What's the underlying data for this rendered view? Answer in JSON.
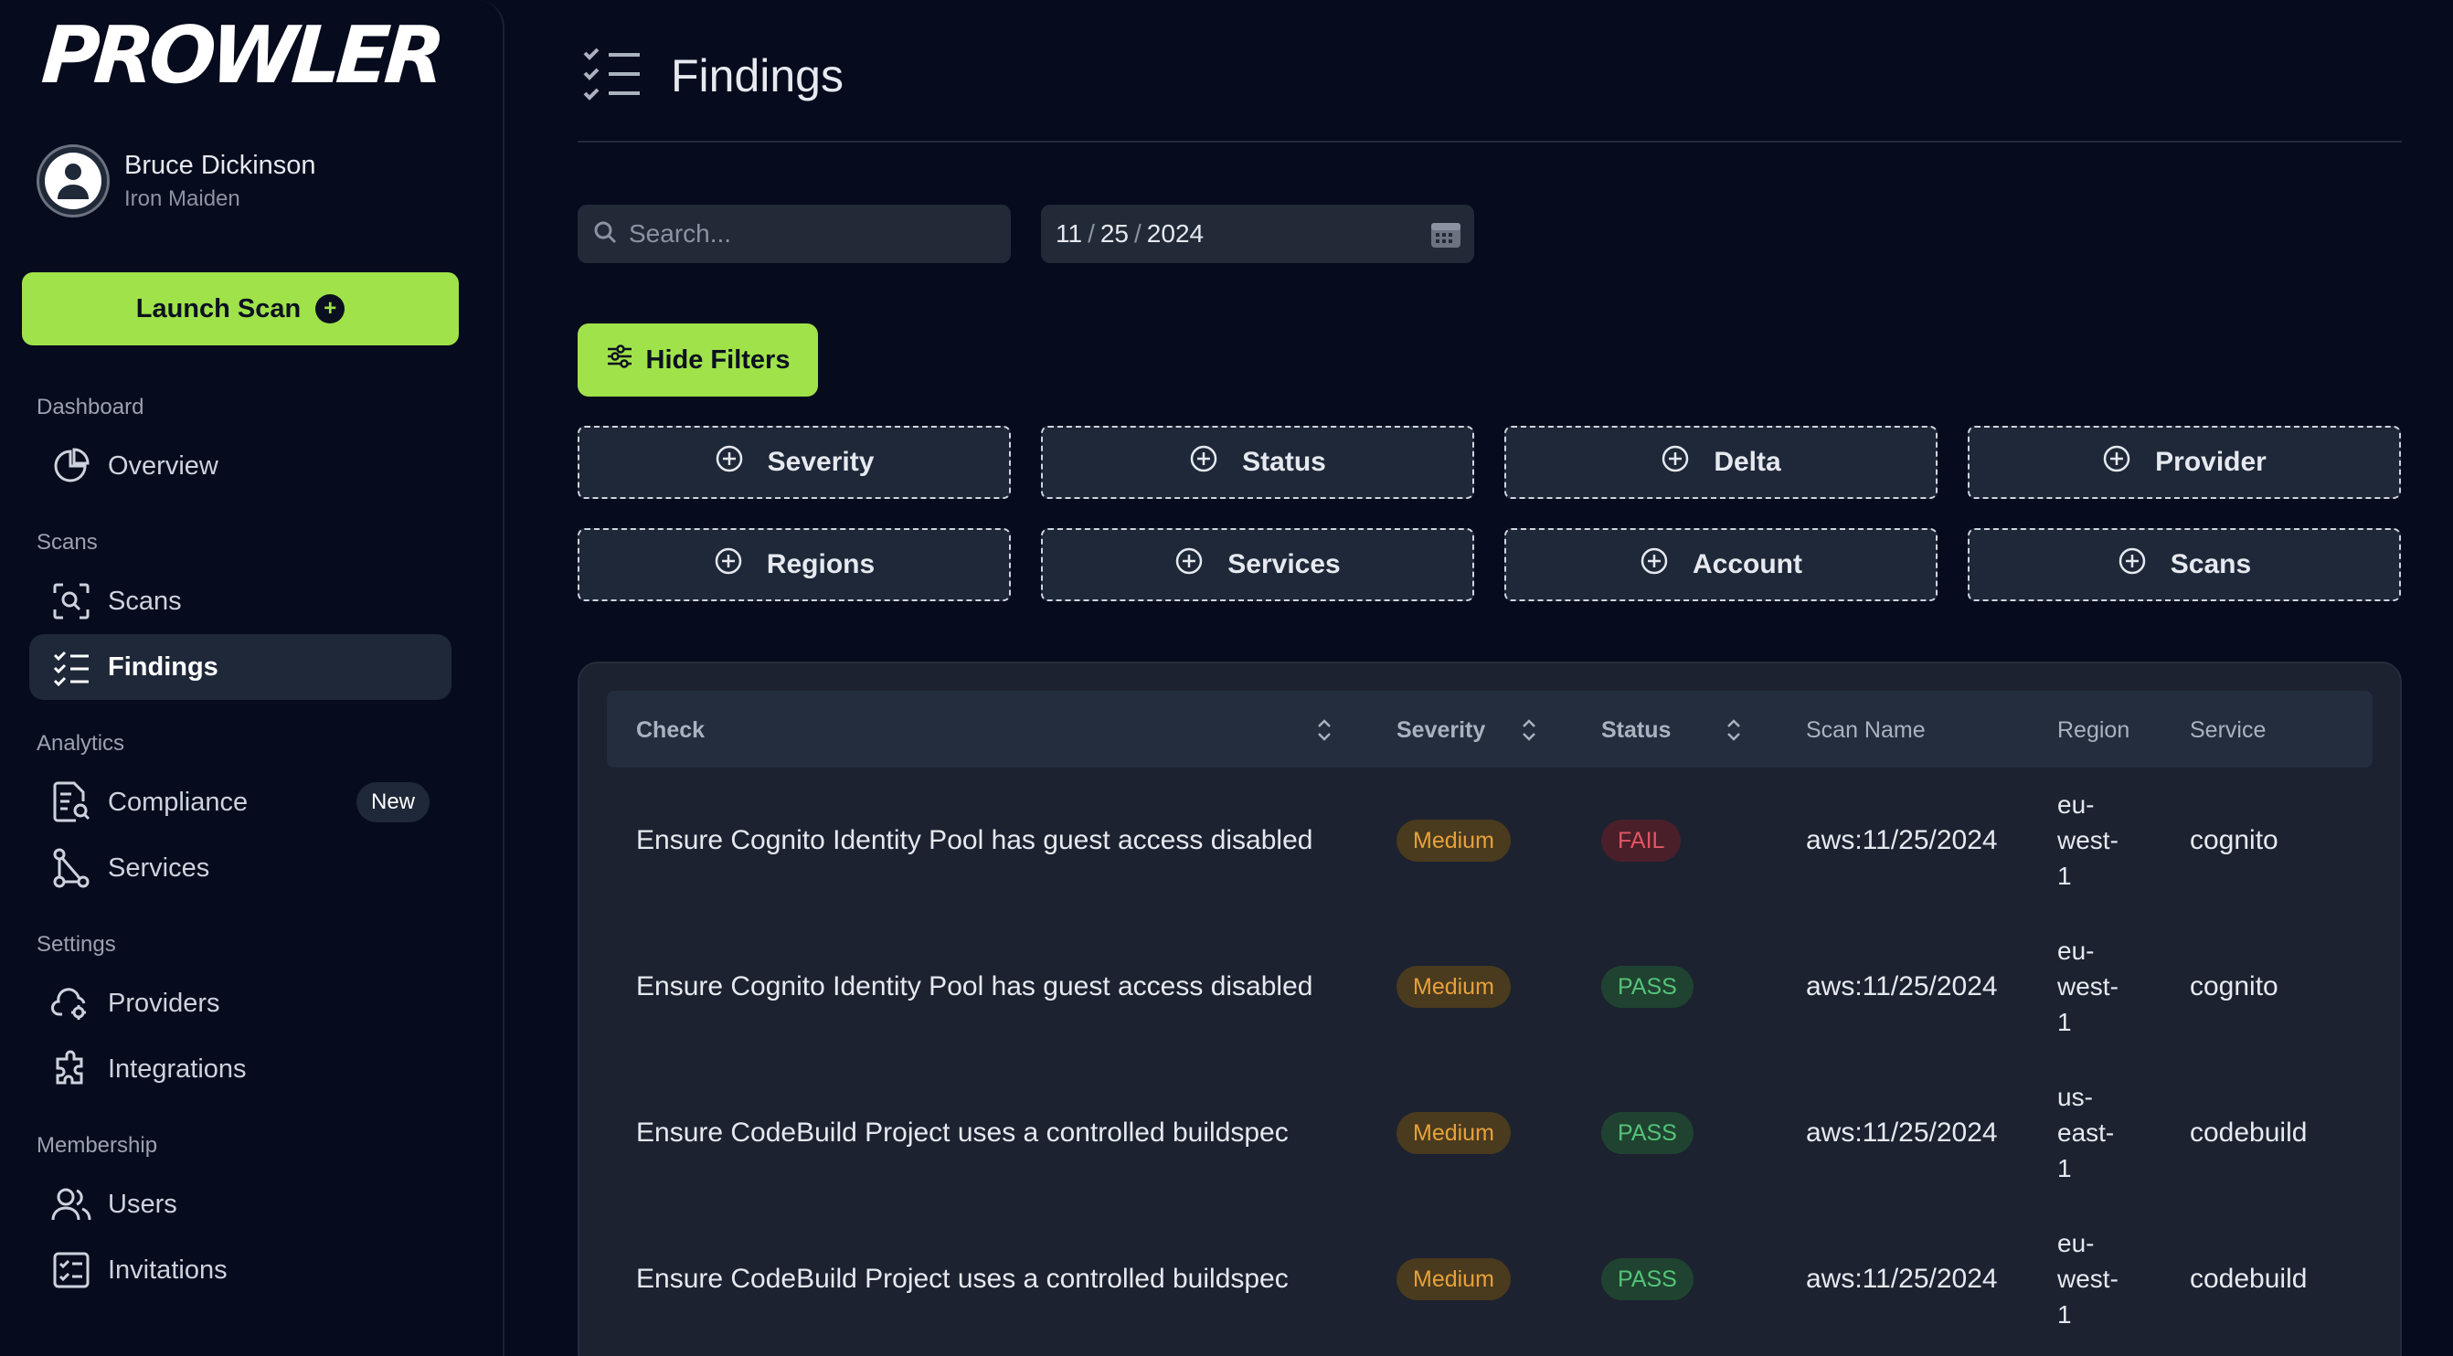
{
  "app": {
    "logo": "PROWLER"
  },
  "user": {
    "name": "Bruce Dickinson",
    "org": "Iron Maiden"
  },
  "launch_scan": {
    "label": "Launch Scan"
  },
  "nav": {
    "dashboard": {
      "title": "Dashboard",
      "overview": "Overview"
    },
    "scans": {
      "title": "Scans",
      "scans": "Scans",
      "findings": "Findings"
    },
    "analytics": {
      "title": "Analytics",
      "compliance": "Compliance",
      "compliance_badge": "New",
      "services": "Services"
    },
    "settings": {
      "title": "Settings",
      "providers": "Providers",
      "integrations": "Integrations"
    },
    "membership": {
      "title": "Membership",
      "users": "Users",
      "invitations": "Invitations"
    }
  },
  "page": {
    "title": "Findings"
  },
  "search": {
    "placeholder": "Search..."
  },
  "date": {
    "month": "11",
    "day": "25",
    "year": "2024"
  },
  "hide_filters": {
    "label": "Hide Filters"
  },
  "filters": [
    "Severity",
    "Status",
    "Delta",
    "Provider",
    "Regions",
    "Services",
    "Account",
    "Scans"
  ],
  "table": {
    "headers": {
      "check": "Check",
      "severity": "Severity",
      "status": "Status",
      "scan_name": "Scan Name",
      "region": "Region",
      "service": "Service"
    },
    "rows": [
      {
        "check": "Ensure Cognito Identity Pool has guest access disabled",
        "severity": "Medium",
        "status": "FAIL",
        "scan_name": "aws:11/25/2024",
        "region": [
          "eu-",
          "west-",
          "1"
        ],
        "service": "cognito"
      },
      {
        "check": "Ensure Cognito Identity Pool has guest access disabled",
        "severity": "Medium",
        "status": "PASS",
        "scan_name": "aws:11/25/2024",
        "region": [
          "eu-",
          "west-",
          "1"
        ],
        "service": "cognito"
      },
      {
        "check": "Ensure CodeBuild Project uses a controlled buildspec",
        "severity": "Medium",
        "status": "PASS",
        "scan_name": "aws:11/25/2024",
        "region": [
          "us-",
          "east-",
          "1"
        ],
        "service": "codebuild"
      },
      {
        "check": "Ensure CodeBuild Project uses a controlled buildspec",
        "severity": "Medium",
        "status": "PASS",
        "scan_name": "aws:11/25/2024",
        "region": [
          "eu-",
          "west-",
          "1"
        ],
        "service": "codebuild"
      }
    ]
  },
  "colors": {
    "accent": "#9fe24a",
    "background": "#060b1d",
    "fail": "#e25563",
    "pass": "#56c27a",
    "medium": "#e7a23a"
  }
}
